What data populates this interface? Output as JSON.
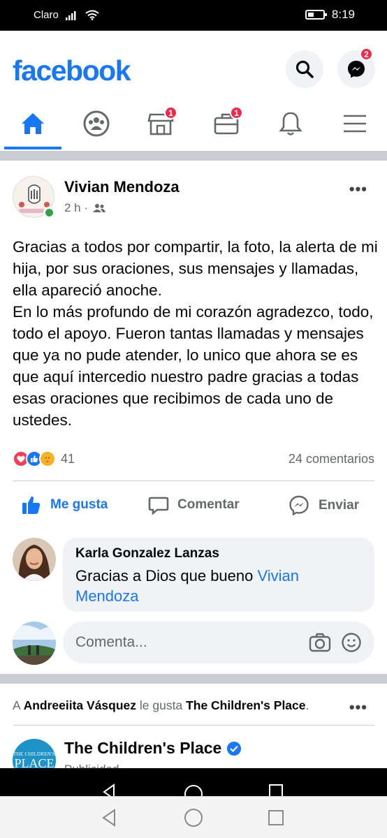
{
  "status_bar": {
    "carrier": "Claro",
    "time": "8:19"
  },
  "header": {
    "logo": "facebook",
    "messenger_badge": "2"
  },
  "tabs": {
    "items": [
      {
        "name": "home",
        "active": true
      },
      {
        "name": "groups"
      },
      {
        "name": "marketplace",
        "badge": "1"
      },
      {
        "name": "jobs",
        "badge": "1"
      },
      {
        "name": "notifications"
      },
      {
        "name": "menu"
      }
    ]
  },
  "post": {
    "author": "Vivian Mendoza",
    "time": "2 h ·",
    "audience_icon": "friends-icon",
    "text": "Gracias a todos por compartir, la foto, la alerta de mi hija, por sus oraciones, sus mensajes y llamadas, ella apareció anoche.\nEn lo más profundo de mi corazón agradezco, todo, todo el apoyo. Fueron tantas llamadas y mensajes que ya no pude atender, lo unico que ahora se es que aquí intercedio  nuestro padre gracias a todas esas oraciones que recibimos de cada uno de ustedes.",
    "reactions_count": "41",
    "comments_count": "24 comentarios",
    "actions": {
      "like": "Me gusta",
      "comment": "Comentar",
      "send": "Enviar"
    },
    "top_comment": {
      "author": "Karla Gonzalez Lanzas",
      "text": "Gracias a Dios que bueno ",
      "mention": "Vivian Mendoza"
    },
    "comment_placeholder": "Comenta..."
  },
  "feed_story": {
    "actor": "Andreeiita Vásquez",
    "verb": " le gusta ",
    "page": "The Children's Place",
    "prefix": "A ",
    "suffix": ".",
    "page_name": "The Children's Place",
    "page_logo_line1": "THE CHILDREN'S",
    "page_logo_line2": "PLACE",
    "sponsored": "Publicidad ·"
  },
  "colors": {
    "brand": "#1877f2",
    "badge": "#f02849",
    "online": "#31a24c"
  }
}
